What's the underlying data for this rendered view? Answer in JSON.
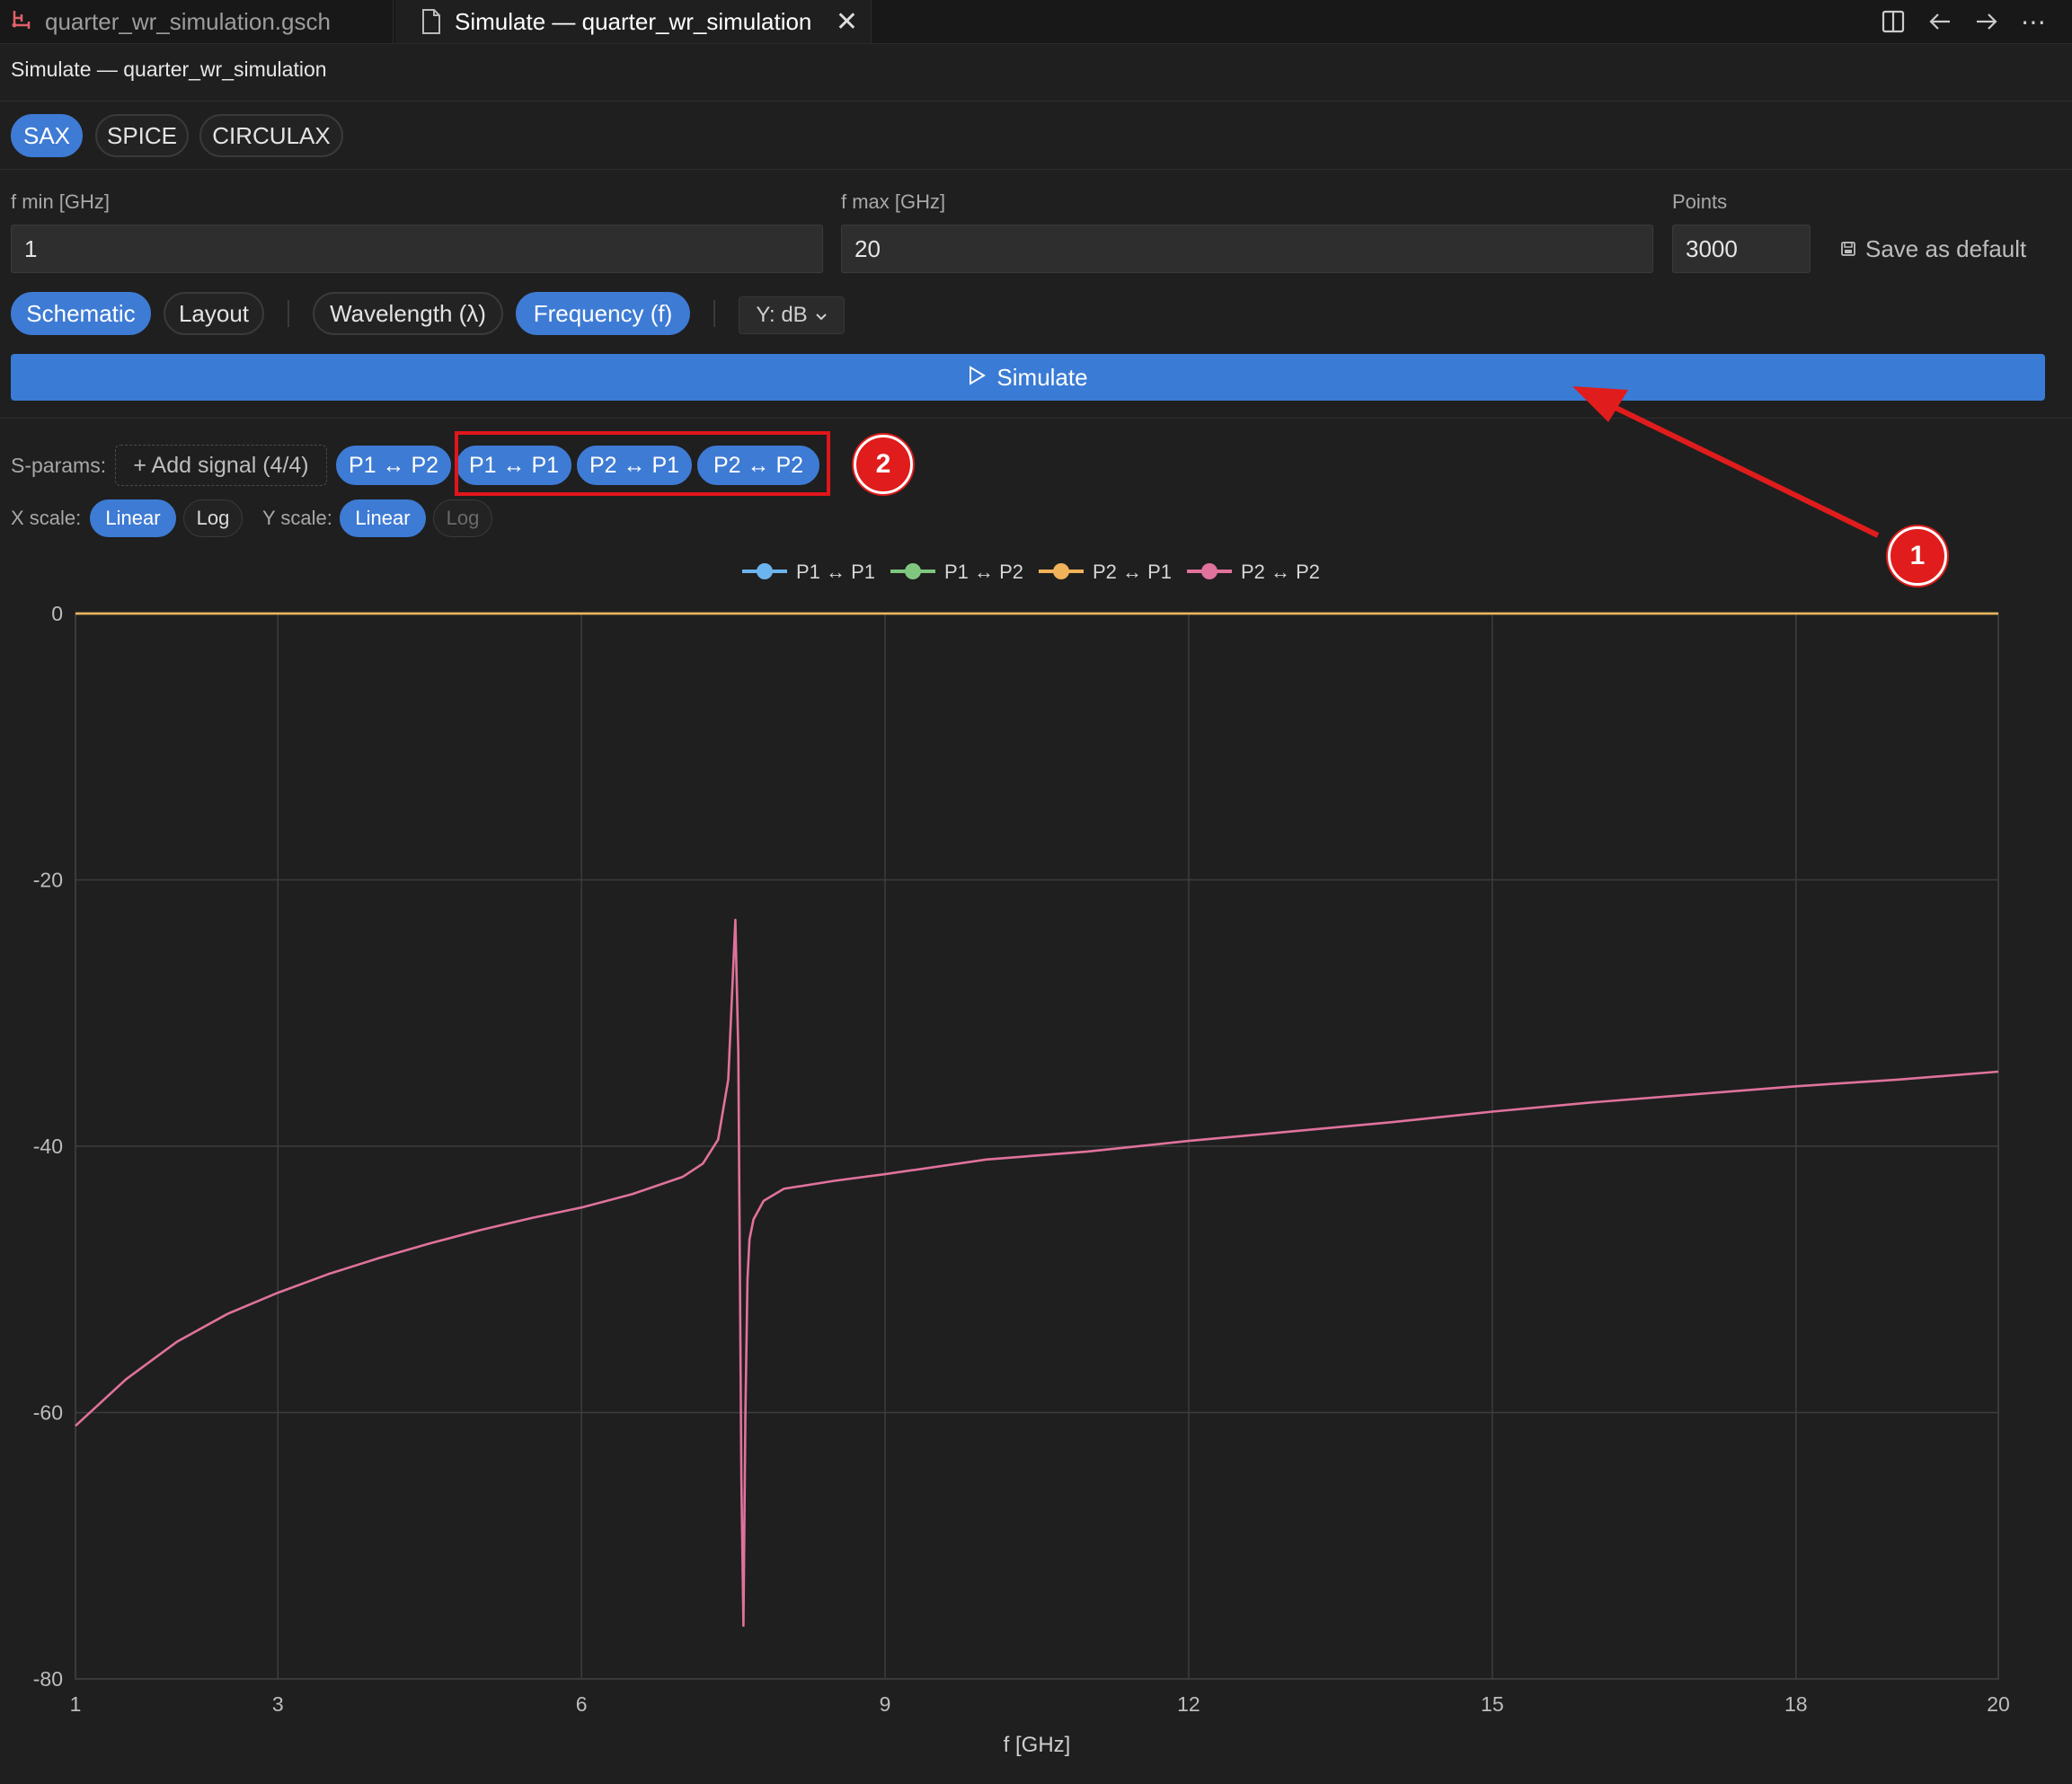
{
  "tabs": [
    {
      "label": "quarter_wr_simulation.gsch",
      "icon": "schematic-icon"
    },
    {
      "label": "Simulate — quarter_wr_simulation",
      "icon": "file-icon",
      "active": true
    }
  ],
  "titlebar_icons": [
    "split-editor-icon",
    "back-arrow-icon",
    "forward-arrow-icon",
    "more-icon"
  ],
  "header": {
    "title": "Simulate — quarter_wr_simulation"
  },
  "engines": [
    {
      "label": "SAX",
      "active": true
    },
    {
      "label": "SPICE",
      "active": false
    },
    {
      "label": "CIRCULAX",
      "active": false
    }
  ],
  "inputs": {
    "fmin": {
      "label": "f min [GHz]",
      "value": "1"
    },
    "fmax": {
      "label": "f max [GHz]",
      "value": "20"
    },
    "points": {
      "label": "Points",
      "value": "3000"
    },
    "save_default": "Save as default"
  },
  "view_toggles": [
    {
      "label": "Schematic",
      "active": true
    },
    {
      "label": "Layout",
      "active": false
    },
    {
      "label": "Wavelength (λ)",
      "active": false
    },
    {
      "label": "Frequency (f)",
      "active": true
    }
  ],
  "y_mode": "Y: dB",
  "simulate_label": "Simulate",
  "sparams": {
    "label": "S-params:",
    "add_signal": "+ Add signal (4/4)",
    "signals": [
      "P1 ↔ P2",
      "P1 ↔ P1",
      "P2 ↔ P1",
      "P2 ↔ P2"
    ]
  },
  "scales": {
    "x_label": "X scale:",
    "y_label": "Y scale:",
    "linear": "Linear",
    "log": "Log"
  },
  "annotations": {
    "badge1": "1",
    "badge2": "2"
  },
  "colors": {
    "accent": "#3e7bd4",
    "annotation_red": "#e01c1c",
    "s11": "#6cb4ee",
    "s12": "#7fc77f",
    "s21": "#f0b35a",
    "s22": "#e0729c"
  },
  "chart_data": {
    "type": "line",
    "xlabel": "f [GHz]",
    "ylabel": "",
    "xlim": [
      1,
      20
    ],
    "ylim": [
      -80,
      0
    ],
    "x_ticks": [
      1,
      3,
      6,
      9,
      12,
      15,
      18,
      20
    ],
    "y_ticks": [
      0,
      -20,
      -40,
      -60,
      -80
    ],
    "grid": true,
    "legend_position": "top-center",
    "series": [
      {
        "name": "P1 ↔ P1",
        "color": "#6cb4ee",
        "x": [],
        "y": []
      },
      {
        "name": "P1 ↔ P2",
        "color": "#7fc77f",
        "x": [
          1,
          20
        ],
        "y": [
          0,
          0
        ]
      },
      {
        "name": "P2 ↔ P1",
        "color": "#f0b35a",
        "x": [
          1,
          20
        ],
        "y": [
          0,
          0
        ]
      },
      {
        "name": "P2 ↔ P2",
        "color": "#e0729c",
        "x": [
          1,
          1.5,
          2,
          2.5,
          3,
          3.5,
          4,
          4.5,
          5,
          5.5,
          6,
          6.5,
          7,
          7.2,
          7.35,
          7.45,
          7.52,
          7.55,
          7.58,
          7.6,
          7.62,
          7.64,
          7.66,
          7.7,
          7.8,
          8,
          8.5,
          9,
          10,
          11,
          12,
          13,
          14,
          15,
          16,
          17,
          18,
          19,
          20
        ],
        "y": [
          -61,
          -57.5,
          -54.7,
          -52.6,
          -51,
          -49.6,
          -48.4,
          -47.3,
          -46.3,
          -45.4,
          -44.6,
          -43.6,
          -42.3,
          -41.3,
          -39.5,
          -35,
          -23,
          -33,
          -65,
          -76,
          -60,
          -50,
          -47,
          -45.5,
          -44.1,
          -43.2,
          -42.6,
          -42.1,
          -41,
          -40.4,
          -39.6,
          -38.9,
          -38.2,
          -37.4,
          -36.7,
          -36.1,
          -35.5,
          -35,
          -34.4
        ]
      }
    ]
  }
}
